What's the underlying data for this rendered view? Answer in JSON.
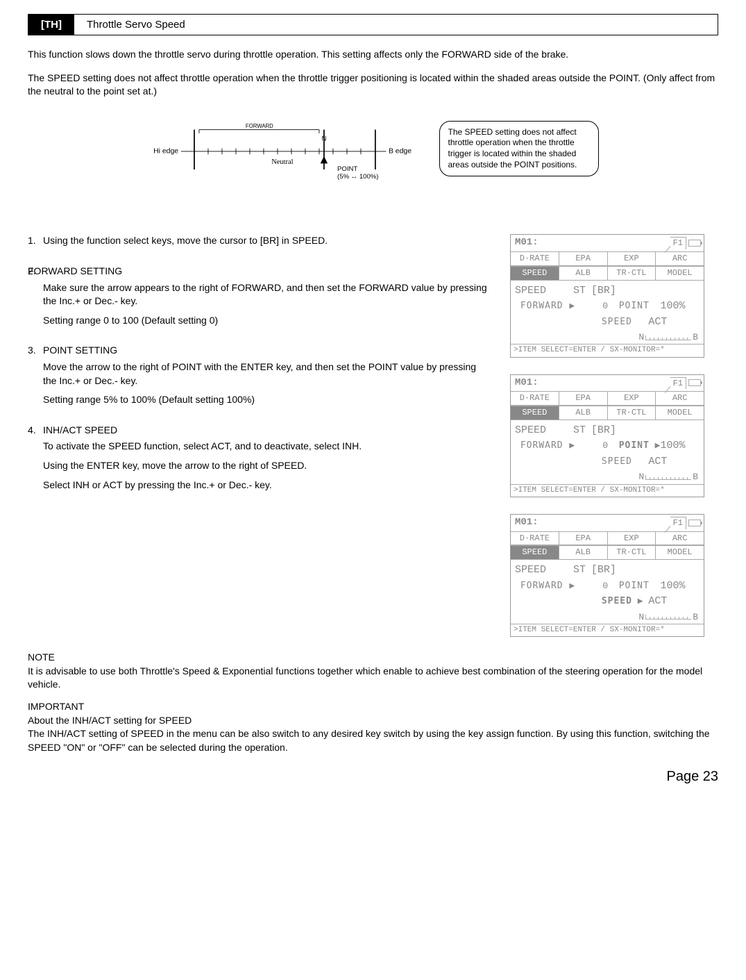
{
  "section": {
    "tag": "[TH]",
    "title": "Throttle Servo Speed"
  },
  "intro": {
    "p1": "This function slows down the throttle servo during throttle operation. This setting affects only the FORWARD side of the brake.",
    "p2": "The SPEED setting does not affect throttle operation when the throttle trigger positioning is located within the shaded areas outside the POINT. (Only affect from the neutral to the point set at.)"
  },
  "diagram": {
    "hi_edge": "Hi edge",
    "b_edge": "B edge",
    "forward": "FORWARD",
    "n": "N",
    "neutral": "Neutral",
    "point": "POINT",
    "point_range": "(5% ↔ 100%)"
  },
  "speed_note": "The SPEED setting does not affect throttle operation when the throttle trigger is located within the shaded areas outside the POINT positions.",
  "steps": [
    {
      "n": "1.",
      "title": "",
      "text": "Using the function select keys, move the cursor to [BR] in SPEED."
    },
    {
      "n": "2.",
      "title": "FORWARD SETTING",
      "text": "Make sure the arrow appears to the right of FORWARD, and then set the FORWARD value by pressing the Inc.+ or Dec.- key.",
      "range": "Setting range 0 to 100 (Default setting  0)"
    },
    {
      "n": "3.",
      "title": "POINT SETTING",
      "text": "Move the arrow to the right of POINT with the ENTER key, and then set the POINT value by pressing the Inc.+ or Dec.- key.",
      "range": "Setting range 5% to 100% (Default setting 100%)"
    },
    {
      "n": "4.",
      "title": "INH/ACT SPEED",
      "text": "To activate the SPEED function, select ACT, and to deactivate, select INH.",
      "extra1": "Using the ENTER key, move the arrow to the right of SPEED.",
      "extra2": "Select INH or ACT by pressing the Inc.+ or Dec.- key."
    }
  ],
  "lcd_common": {
    "model": "M01:",
    "f1": "F1",
    "tabs_row1": [
      "D·RATE",
      "EPA",
      "EXP",
      "ARC"
    ],
    "tabs_row2": [
      "SPEED",
      "ALB",
      "TR·CTL",
      "MODEL"
    ],
    "active_tab": "SPEED",
    "speed_label": "SPEED",
    "st_label": "ST",
    "br_label": "[BR]",
    "forward_label": "FORWARD ▶",
    "point_label": "POINT",
    "speed_row_label": "SPEED",
    "n_mark": "N",
    "b_mark": "B",
    "footer": ">ITEM SELECT=ENTER / SX-MONITOR=*"
  },
  "lcd1": {
    "forward_val": "0",
    "point_val": "100%",
    "speed_val": "ACT",
    "point_cursor": false,
    "speed_cursor": false
  },
  "lcd2": {
    "forward_val": "0",
    "point_val": "100%",
    "speed_val": "ACT",
    "point_cursor": true,
    "speed_cursor": false
  },
  "lcd3": {
    "forward_val": "0",
    "point_val": "100%",
    "speed_val": "ACT",
    "point_cursor": false,
    "speed_cursor": true
  },
  "note": {
    "title": "NOTE",
    "body": "It is advisable to use both Throttle's Speed & Exponential functions together which enable to achieve best combination of the steering operation for the model vehicle."
  },
  "important": {
    "title": "IMPORTANT",
    "sub": "About the INH/ACT setting for SPEED",
    "body": "The INH/ACT setting of SPEED in the menu can be also switch to any desired key switch by using the key assign function. By using this function, switching the SPEED \"ON\" or \"OFF\" can be selected during the operation."
  },
  "page": "Page 23"
}
